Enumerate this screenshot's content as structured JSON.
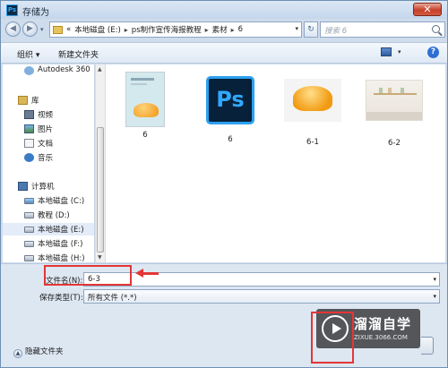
{
  "window": {
    "title": "存储为"
  },
  "address": {
    "prefix": "«",
    "crumbs": [
      "本地磁盘 (E:)",
      "ps制作宣传海报教程",
      "素材",
      "6"
    ],
    "separator": "▸"
  },
  "search": {
    "placeholder": "搜索 6"
  },
  "toolbar": {
    "organize": "组织 ▾",
    "new_folder": "新建文件夹"
  },
  "sidebar": {
    "items": [
      {
        "label": "Autodesk 360",
        "icon": "cloud-icon"
      },
      {
        "label": "库",
        "icon": "library-icon"
      },
      {
        "label": "视频",
        "icon": "video-icon"
      },
      {
        "label": "图片",
        "icon": "picture-icon"
      },
      {
        "label": "文档",
        "icon": "document-icon"
      },
      {
        "label": "音乐",
        "icon": "music-icon"
      },
      {
        "label": "计算机",
        "icon": "computer-icon"
      },
      {
        "label": "本地磁盘 (C:)",
        "icon": "drive-icon"
      },
      {
        "label": "教程 (D:)",
        "icon": "drive-icon"
      },
      {
        "label": "本地磁盘 (E:)",
        "icon": "drive-icon",
        "selected": true
      },
      {
        "label": "本地磁盘 (F:)",
        "icon": "drive-icon"
      },
      {
        "label": "本地磁盘 (H:)",
        "icon": "drive-icon"
      }
    ]
  },
  "files": [
    {
      "name": "6",
      "thumb": "poster"
    },
    {
      "name": "6",
      "thumb": "photoshop-icon"
    },
    {
      "name": "6-1",
      "thumb": "pudding"
    },
    {
      "name": "6-2",
      "thumb": "kitchen"
    }
  ],
  "form": {
    "filename_label": "文件名(N):",
    "filename_value": "6-3",
    "type_label": "保存类型(T):",
    "type_value": "所有文件 (*.*)",
    "hide_folders": "隐藏文件夹"
  },
  "watermark": {
    "title": "溜溜自学",
    "url": "ZIXUE.3066.COM"
  },
  "colors": {
    "annotation": "#e33636",
    "selection": "#e3ecf8",
    "accent": "#31a8ff"
  }
}
